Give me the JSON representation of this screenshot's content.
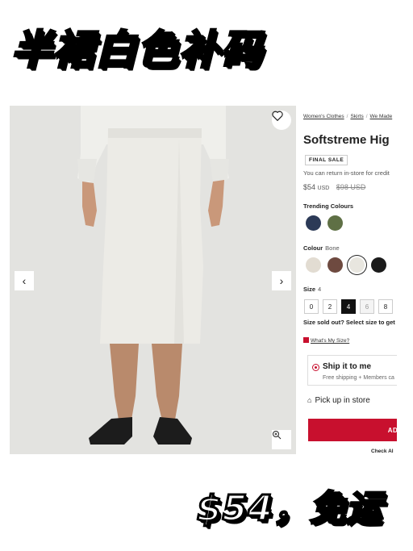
{
  "overlay": {
    "headline": "半裙白色补码",
    "promo": "$54，免运"
  },
  "breadcrumb": {
    "items": [
      "Women's Clothes",
      "Skirts",
      "We Made"
    ]
  },
  "product": {
    "title": "Softstreme Hig",
    "badge": "FINAL SALE",
    "return_note": "You can return in-store for credit",
    "price": "$54",
    "price_currency": "USD",
    "was_price": "$98 USD"
  },
  "trending": {
    "label": "Trending Colours",
    "swatches": [
      "#2c3a57",
      "#5f7045"
    ]
  },
  "colour": {
    "label": "Colour",
    "selected": "Bone",
    "swatches": [
      "#e2dcd2",
      "#6e4a40",
      "#e8e6df",
      "#1b1b1b"
    ]
  },
  "size": {
    "label": "Size",
    "selected": "4",
    "options": [
      "0",
      "2",
      "4",
      "6",
      "8"
    ],
    "sold_out_note": "Size sold out? Select size to get",
    "guide_link": "What's My Size?"
  },
  "shipping": {
    "ship_title": "Ship it to me",
    "ship_sub": "Free shipping + Members ca",
    "pickup": "Pick up in store"
  },
  "actions": {
    "add_label": "AD",
    "check_all": "Check Al"
  },
  "icons": {
    "wishlist": "heart-icon",
    "prev": "chevron-left-icon",
    "next": "chevron-right-icon",
    "zoom": "zoom-in-icon",
    "store": "store-icon"
  },
  "colors": {
    "brand_red": "#c8102e"
  }
}
